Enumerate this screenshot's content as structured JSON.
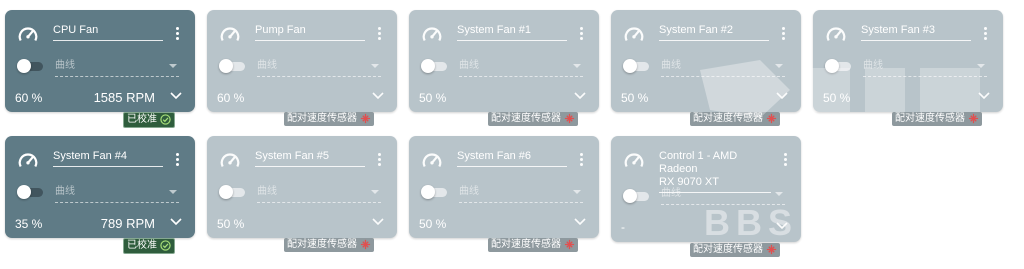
{
  "fans": [
    {
      "title": "CPU Fan",
      "mode": "曲线",
      "percent": "60 %",
      "rpm": "1585 RPM",
      "status": "已校准",
      "active": true
    },
    {
      "title": "Pump Fan",
      "mode": "曲线",
      "percent": "60 %",
      "rpm": "",
      "status": "配对速度传感器",
      "active": false
    },
    {
      "title": "System Fan #1",
      "mode": "曲线",
      "percent": "50 %",
      "rpm": "",
      "status": "配对速度传感器",
      "active": false
    },
    {
      "title": "System Fan #2",
      "mode": "曲线",
      "percent": "50 %",
      "rpm": "",
      "status": "配对速度传感器",
      "active": false
    },
    {
      "title": "System Fan #3",
      "mode": "曲线",
      "percent": "50 %",
      "rpm": "",
      "status": "配对速度传感器",
      "active": false
    },
    {
      "title": "System Fan #4",
      "mode": "曲线",
      "percent": "35 %",
      "rpm": "789 RPM",
      "status": "已校准",
      "active": true
    },
    {
      "title": "System Fan #5",
      "mode": "曲线",
      "percent": "50 %",
      "rpm": "",
      "status": "配对速度传感器",
      "active": false
    },
    {
      "title": "System Fan #6",
      "mode": "曲线",
      "percent": "50 %",
      "rpm": "",
      "status": "配对速度传感器",
      "active": false
    },
    {
      "title_line1": "Control 1 - AMD Radeon",
      "title_line2": "RX 9070 XT",
      "mode": "曲线",
      "percent": "-",
      "rpm": "",
      "status": "配对速度传感器",
      "active": false
    }
  ],
  "watermark": "BBS",
  "colors": {
    "active_card": "#5f7b86",
    "inactive_card": "#b8c4ca",
    "calibrated_badge": "#2f5d3d",
    "pair_badge": "#8e999e",
    "pair_icon": "#e05050",
    "check_icon": "#a8e07a"
  }
}
